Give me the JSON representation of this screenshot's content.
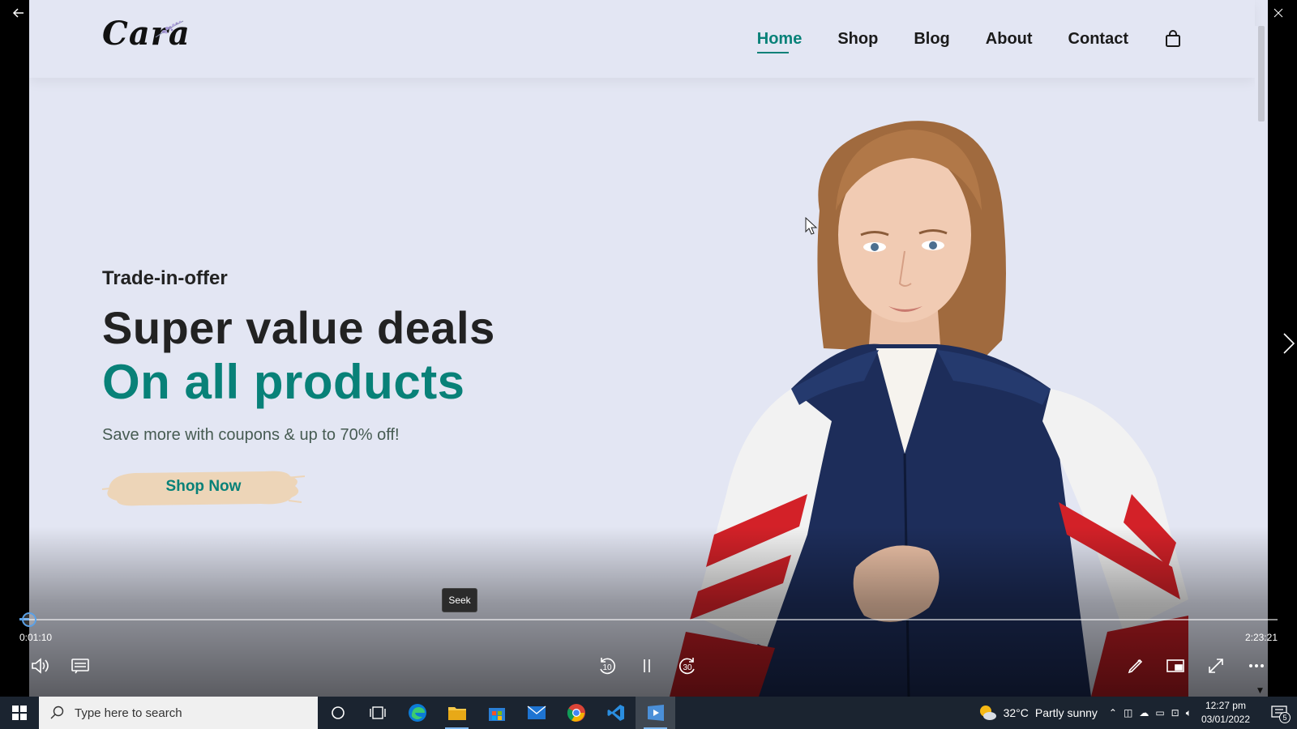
{
  "website": {
    "logo_text": "Cara",
    "nav": [
      {
        "label": "Home",
        "active": true
      },
      {
        "label": "Shop",
        "active": false
      },
      {
        "label": "Blog",
        "active": false
      },
      {
        "label": "About",
        "active": false
      },
      {
        "label": "Contact",
        "active": false
      }
    ],
    "cart_icon": "shopping-bag-icon",
    "hero": {
      "eyebrow": "Trade-in-offer",
      "title": "Super value deals",
      "title_highlight": "On all products",
      "subtitle": "Save more with coupons & up to 70% off!",
      "button_label": "Shop Now"
    },
    "colors": {
      "background": "#e3e6f3",
      "accent": "#088178",
      "button_brush": "#edd5b8"
    }
  },
  "player": {
    "seek_tooltip": "Seek",
    "time_elapsed": "0:01:10",
    "time_total": "2:23:21",
    "progress_fraction": 0.008,
    "skip_back_seconds": "10",
    "skip_forward_seconds": "30",
    "accent": "#5aa0e6"
  },
  "taskbar": {
    "search_placeholder": "Type here to search",
    "apps": [
      "cortana-icon",
      "task-view-icon",
      "edge-icon",
      "file-explorer-icon",
      "microsoft-store-icon",
      "mail-icon",
      "chrome-icon",
      "vscode-icon",
      "media-player-icon"
    ],
    "weather": {
      "temp": "32°C",
      "condition": "Partly sunny"
    },
    "clock": {
      "time": "12:27 pm",
      "date": "03/01/2022"
    },
    "notification_count": "5"
  }
}
